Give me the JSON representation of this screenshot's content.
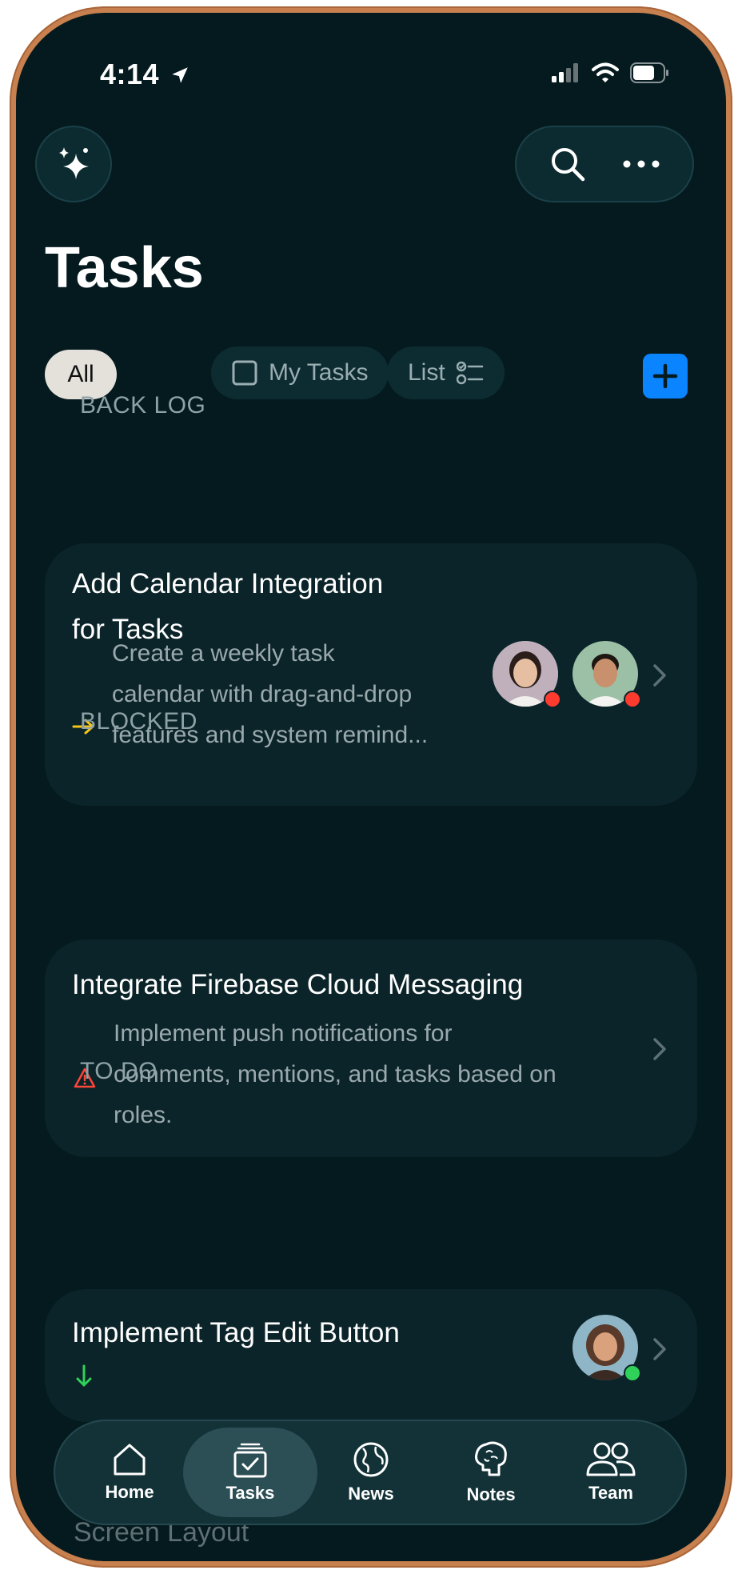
{
  "status": {
    "time": "4:14"
  },
  "header": {
    "ai_icon": "sparkles-icon",
    "search_icon": "search-icon",
    "more_icon": "ellipsis-icon",
    "title": "Tasks"
  },
  "filters": {
    "all": "All",
    "my_tasks": "My Tasks",
    "list": "List",
    "add_icon": "plus-icon"
  },
  "sections": [
    {
      "label": "BACK LOG",
      "task": {
        "title_line1": "Add Calendar Integration",
        "title_line2": "for Tasks",
        "desc_line1": "Create a weekly task",
        "desc_line2": "calendar with drag-and-drop",
        "desc_line3": "features and system remind...",
        "priority_icon": "arrow-right-icon",
        "priority_color": "#f5c518",
        "assignees": [
          {
            "avatar": "woman-avatar",
            "status_color": "#ff3b30"
          },
          {
            "avatar": "man-avatar",
            "status_color": "#ff3b30"
          }
        ]
      }
    },
    {
      "label": "BLOCKED",
      "task": {
        "title_line1": "Integrate Firebase Cloud Messaging",
        "desc_line1": "Implement push notifications for",
        "desc_line2": "comments, mentions, and tasks based on",
        "desc_line3": "roles.",
        "priority_icon": "warning-triangle-icon",
        "priority_color": "#ff453a"
      }
    },
    {
      "label": "TO DO",
      "task": {
        "title_line1": "Implement Tag Edit Button",
        "priority_icon": "arrow-down-icon",
        "priority_color": "#30d158",
        "assignees": [
          {
            "avatar": "woman-avatar",
            "status_color": "#30d158"
          }
        ]
      }
    }
  ],
  "partial_next_task": {
    "title_line2": "Screen Layout"
  },
  "tabbar": {
    "items": [
      {
        "label": "Home",
        "icon": "house-icon"
      },
      {
        "label": "Tasks",
        "icon": "checklist-icon",
        "active": true
      },
      {
        "label": "News",
        "icon": "globe-icon"
      },
      {
        "label": "Notes",
        "icon": "brain-icon"
      },
      {
        "label": "Team",
        "icon": "people-icon"
      }
    ]
  },
  "colors": {
    "background": "#041a1f",
    "card": "#0b2429",
    "accent": "#0a84ff",
    "frame": "#c8804f"
  }
}
